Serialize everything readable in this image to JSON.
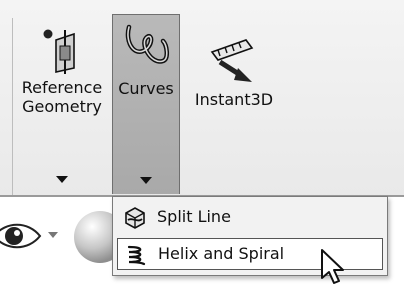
{
  "ribbon": {
    "reference_geometry": {
      "label_line1": "Reference",
      "label_line2": "Geometry",
      "icon": "reference-plane-icon"
    },
    "curves": {
      "label": "Curves",
      "icon": "curves-icon",
      "state": "expanded"
    },
    "instant3d": {
      "label": "Instant3D",
      "icon": "instant3d-icon"
    }
  },
  "curves_menu": {
    "items": [
      {
        "label": "Split Line",
        "icon": "split-line-icon"
      },
      {
        "label": "Helix and Spiral",
        "icon": "helix-spiral-icon",
        "state": "hovered"
      }
    ]
  },
  "view_toolbar": {
    "icons": [
      "eye-icon",
      "appearance-sphere-icon"
    ]
  },
  "colors": {
    "ribbon_bg": "#eeeeee",
    "active_button": "#b0b0b0",
    "menu_bg": "#f2f2f2",
    "hover_item": "#ffffff"
  }
}
